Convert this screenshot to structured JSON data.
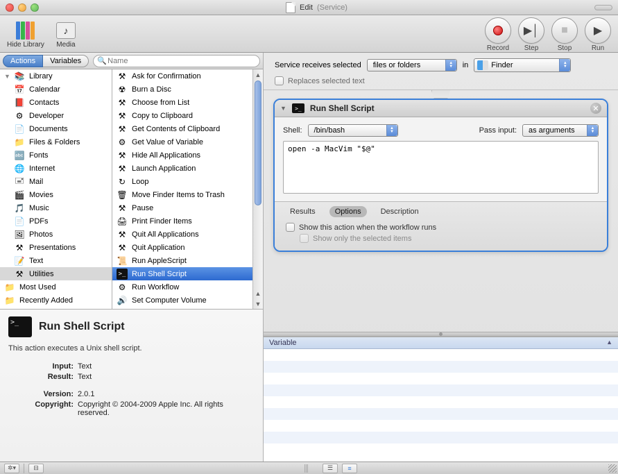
{
  "window": {
    "title": "Edit",
    "subtitle": "(Service)"
  },
  "toolbar": {
    "hide_library": "Hide Library",
    "media": "Media",
    "record": "Record",
    "step": "Step",
    "stop": "Stop",
    "run": "Run"
  },
  "tabs": {
    "actions": "Actions",
    "variables": "Variables"
  },
  "search": {
    "placeholder": "Name"
  },
  "library": {
    "root": "Library",
    "items": [
      "Calendar",
      "Contacts",
      "Developer",
      "Documents",
      "Files & Folders",
      "Fonts",
      "Internet",
      "Mail",
      "Movies",
      "Music",
      "PDFs",
      "Photos",
      "Presentations",
      "Text",
      "Utilities"
    ],
    "most_used": "Most Used",
    "recently_added": "Recently Added"
  },
  "actions": [
    "Ask for Confirmation",
    "Burn a Disc",
    "Choose from List",
    "Copy to Clipboard",
    "Get Contents of Clipboard",
    "Get Value of Variable",
    "Hide All Applications",
    "Launch Application",
    "Loop",
    "Move Finder Items to Trash",
    "Pause",
    "Print Finder Items",
    "Quit All Applications",
    "Quit Application",
    "Run AppleScript",
    "Run Shell Script",
    "Run Workflow",
    "Set Computer Volume"
  ],
  "selected_action_index": 15,
  "info": {
    "title": "Run Shell Script",
    "desc": "This action executes a Unix shell script.",
    "input_label": "Input:",
    "input_value": "Text",
    "result_label": "Result:",
    "result_value": "Text",
    "version_label": "Version:",
    "version_value": "2.0.1",
    "copyright_label": "Copyright:",
    "copyright_value": "Copyright © 2004-2009 Apple Inc.  All rights reserved."
  },
  "service": {
    "receives_label": "Service receives selected",
    "receives_value": "files or folders",
    "in_label": "in",
    "app_value": "Finder",
    "replaces": "Replaces selected text"
  },
  "shell_action": {
    "title": "Run Shell Script",
    "shell_label": "Shell:",
    "shell_value": "/bin/bash",
    "pass_label": "Pass input:",
    "pass_value": "as arguments",
    "script": "open -a MacVim \"$@\"",
    "tab_results": "Results",
    "tab_options": "Options",
    "tab_description": "Description",
    "opt_show": "Show this action when the workflow runs",
    "opt_selected": "Show only the selected items"
  },
  "variable_header": "Variable"
}
